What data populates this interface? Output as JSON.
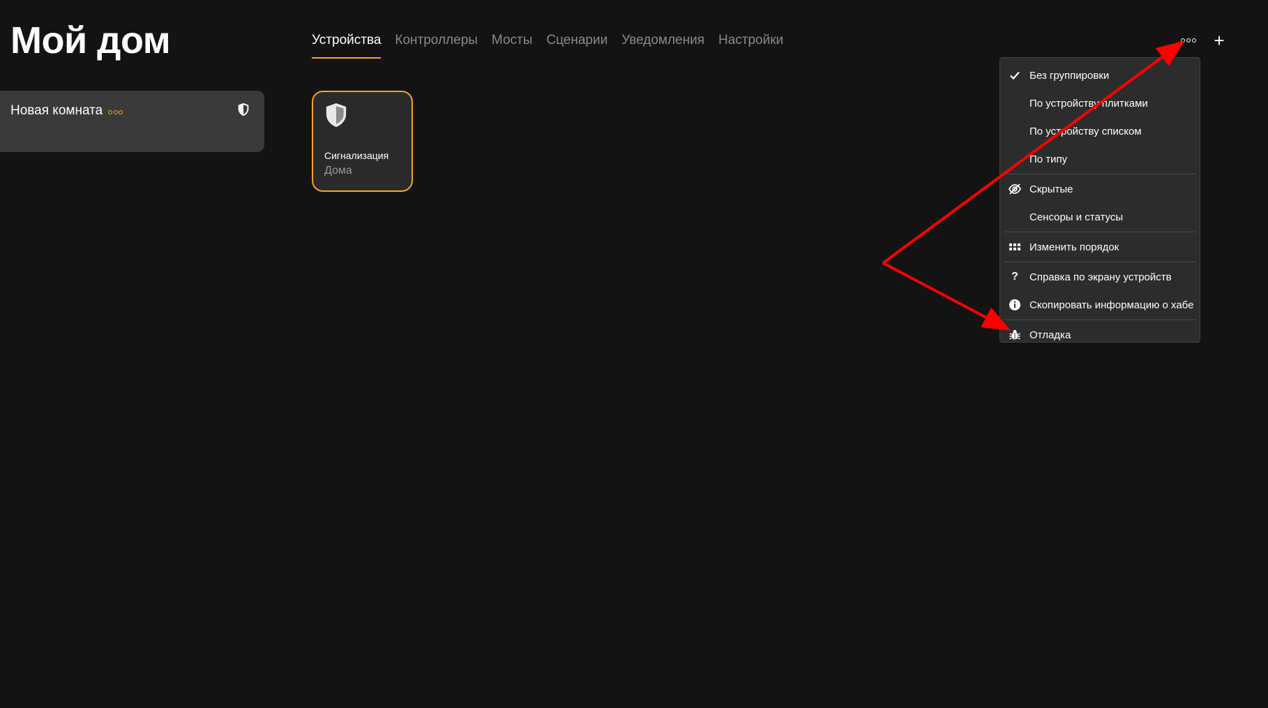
{
  "app": {
    "title": "Мой дом"
  },
  "tabs": [
    {
      "label": "Устройства",
      "active": true
    },
    {
      "label": "Контроллеры",
      "active": false
    },
    {
      "label": "Мосты",
      "active": false
    },
    {
      "label": "Сценарии",
      "active": false
    },
    {
      "label": "Уведомления",
      "active": false
    },
    {
      "label": "Настройки",
      "active": false
    }
  ],
  "header": {
    "more_icon": "more-dots-icon",
    "add_label": "+"
  },
  "room": {
    "name": "Новая комната",
    "icon": "shield-icon"
  },
  "device": {
    "name": "Сигнализация",
    "room": "Дома",
    "icon": "shield-icon"
  },
  "menu": {
    "items": [
      {
        "label": "Без группировки",
        "icon": "check-icon",
        "checked": true
      },
      {
        "label": "По устройству плитками",
        "icon": ""
      },
      {
        "label": "По устройству списком",
        "icon": ""
      },
      {
        "label": "По типу",
        "icon": ""
      },
      {
        "label": "Скрытые",
        "icon": "eye-off-icon"
      },
      {
        "label": "Сенсоры и статусы",
        "icon": ""
      },
      {
        "label": "Изменить порядок",
        "icon": "grid-icon"
      },
      {
        "label": "Справка по экрану устройств",
        "icon": "question-icon"
      },
      {
        "label": "Скопировать информацию о хабе",
        "icon": "info-icon"
      },
      {
        "label": "Отладка",
        "icon": "bug-icon"
      }
    ]
  },
  "colors": {
    "accent": "#f5a623",
    "background": "#131313",
    "annotation_arrow": "#ff0000"
  }
}
